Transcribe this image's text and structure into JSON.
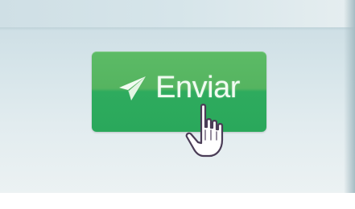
{
  "form": {
    "send_button": {
      "label": "Enviar",
      "icon": "paper-plane-icon",
      "color": "#2eab5e"
    }
  },
  "pointer": {
    "icon": "hand-pointer-icon"
  }
}
